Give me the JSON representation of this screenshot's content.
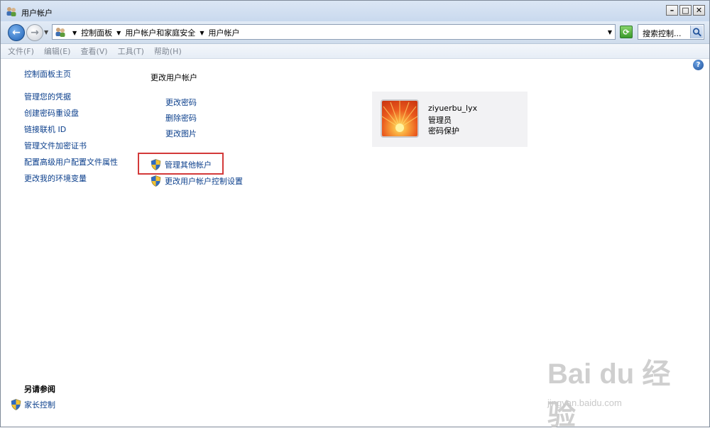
{
  "window": {
    "title": "用户帐户"
  },
  "address": {
    "crumbs": [
      "控制面板",
      "用户帐户和家庭安全",
      "用户帐户"
    ],
    "search_placeholder": "搜索控制..."
  },
  "menu": [
    "文件(F)",
    "编辑(E)",
    "查看(V)",
    "工具(T)",
    "帮助(H)"
  ],
  "left_nav": {
    "home": "控制面板主页",
    "links": [
      "管理您的凭据",
      "创建密码重设盘",
      "链接联机 ID",
      "管理文件加密证书",
      "配置高级用户配置文件属性",
      "更改我的环境变量"
    ],
    "see_also_title": "另请参阅",
    "see_also_links": [
      "家长控制"
    ]
  },
  "main": {
    "title": "更改用户帐户",
    "tasks": [
      "更改密码",
      "删除密码",
      "更改图片"
    ],
    "shield_tasks": [
      "管理其他帐户",
      "更改用户帐户控制设置"
    ]
  },
  "user": {
    "name": "ziyuerbu_lyx",
    "role": "管理员",
    "status": "密码保护"
  },
  "watermark": {
    "main": "Bai du 经验",
    "sub": "jingyan.baidu.com"
  },
  "colors": {
    "link": "#0b3f8c",
    "highlight": "#d33a3a",
    "titlebar": "#dbe6f4"
  }
}
